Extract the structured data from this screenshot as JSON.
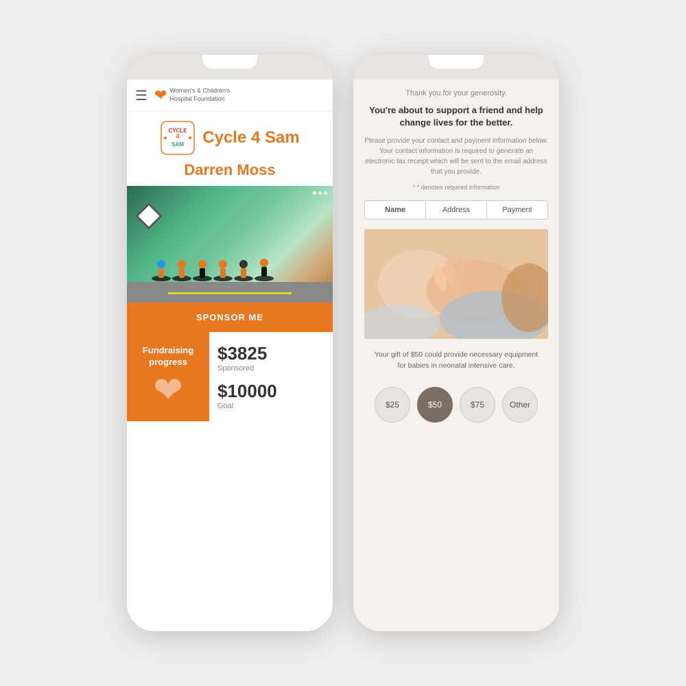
{
  "scene": {
    "background_color": "#f0eeec"
  },
  "left_phone": {
    "header": {
      "org_name_line1": "Women's & Children's",
      "org_name_line2": "Hospital Foundation"
    },
    "campaign": {
      "title": "Cycle 4 Sam",
      "fundraiser_name": "Darren Moss"
    },
    "hero_image_dots": [
      "•",
      "•",
      "•"
    ],
    "sponsor_button": "SPONSOR ME",
    "fundraising": {
      "section_title_line1": "Fundraising",
      "section_title_line2": "progress",
      "sponsored_amount": "$3825",
      "sponsored_label": "Sponsored",
      "goal_amount": "$10000",
      "goal_label": "Goal"
    }
  },
  "right_phone": {
    "thank_you": "Thank you for your generosity.",
    "heading": "You're about to support a friend and help change lives for the better.",
    "body_text": "Please provide your contact and payment information below. Your contact information is required to generate an electronic tax receipt which will be sent to the email address that you provide.",
    "required_note": "* denotes required information",
    "steps": [
      {
        "label": "Name",
        "active": true
      },
      {
        "label": "Address",
        "active": false
      },
      {
        "label": "Payment",
        "active": false
      }
    ],
    "baby_caption": "Your gift of $50 could provide necessary equipment for babies in neonatal intensive care.",
    "amounts": [
      {
        "value": "$25",
        "selected": false
      },
      {
        "value": "$50",
        "selected": true
      },
      {
        "value": "$75",
        "selected": false
      },
      {
        "value": "Other",
        "selected": false
      }
    ]
  }
}
